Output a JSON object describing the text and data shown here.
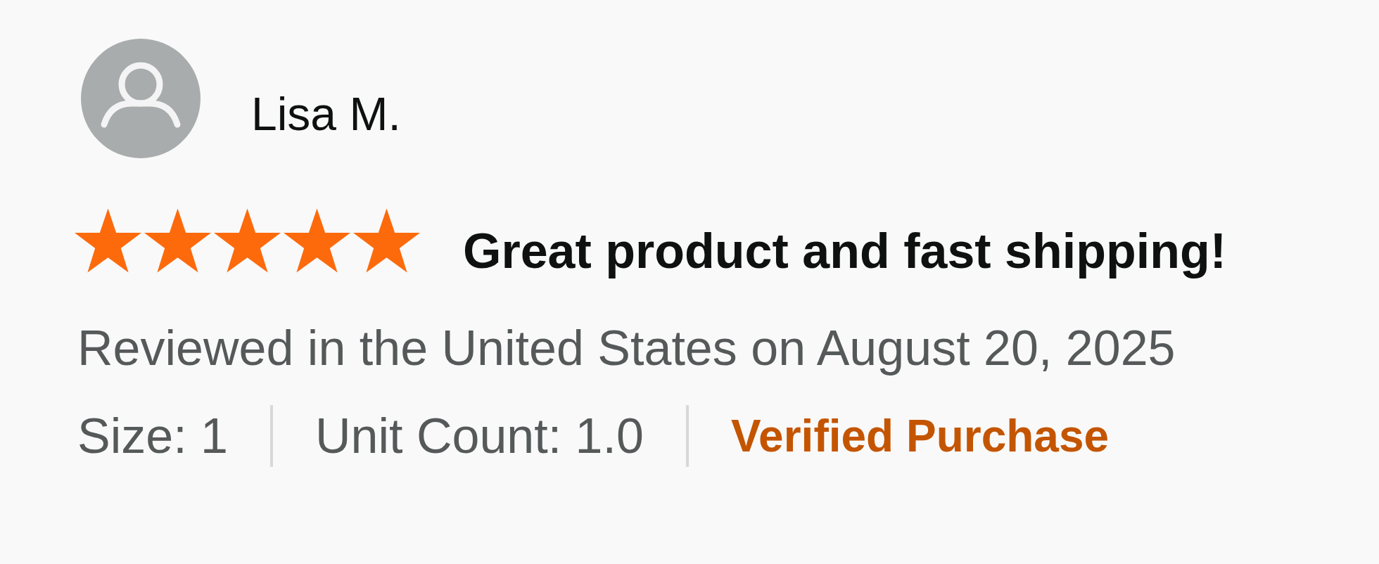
{
  "reviewer": {
    "name": "Lisa M."
  },
  "review": {
    "stars": 5,
    "title": "Great product and fast shipping!",
    "meta": "Reviewed in the United States on August 20, 2025",
    "attributes": [
      "Size: 1",
      "Unit Count: 1.0"
    ],
    "badge": "Verified Purchase"
  }
}
